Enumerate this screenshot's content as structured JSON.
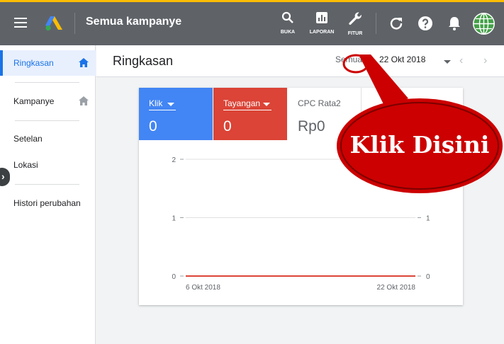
{
  "header": {
    "title": "Semua kampanye",
    "tools": [
      {
        "label": "BUKA",
        "icon": "search-icon"
      },
      {
        "label": "LAPORAN",
        "icon": "bar-chart-icon"
      },
      {
        "label": "FITUR",
        "icon": "wrench-icon"
      }
    ],
    "actions": [
      "refresh-icon",
      "help-icon",
      "bell-icon"
    ],
    "colors": {
      "bar": "#5f6368",
      "accent": "#fbbc04"
    }
  },
  "sidebar": {
    "items": [
      {
        "label": "Ringkasan",
        "active": true
      },
      {
        "label": "Kampanye",
        "active": false
      },
      {
        "label": "Setelan",
        "active": false
      },
      {
        "label": "Lokasi",
        "active": false
      },
      {
        "label": "Histori perubahan",
        "active": false
      }
    ]
  },
  "page": {
    "title": "Ringkasan",
    "date_range_prefix": "Semua",
    "date_range_end": "22 Okt 2018"
  },
  "metrics": [
    {
      "label": "Klik",
      "value": "0",
      "color": "#4285f4",
      "dropdown": true
    },
    {
      "label": "Tayangan",
      "value": "0",
      "color": "#db4437",
      "dropdown": true
    },
    {
      "label": "CPC Rata2",
      "value": "Rp0",
      "color": "#ffffff",
      "dropdown": false
    }
  ],
  "chart_data": {
    "type": "line",
    "x": [
      "6 Okt 2018",
      "22 Okt 2018"
    ],
    "series": [
      {
        "values": [
          0,
          0
        ],
        "color": "#db4437"
      }
    ],
    "y_left_ticks": [
      "2",
      "1",
      "0"
    ],
    "y_right_ticks": [
      "1",
      "0"
    ],
    "ylim": [
      0,
      2
    ],
    "grid": true
  },
  "callout": {
    "text": "Klik Disini",
    "color": "#cc0000"
  }
}
